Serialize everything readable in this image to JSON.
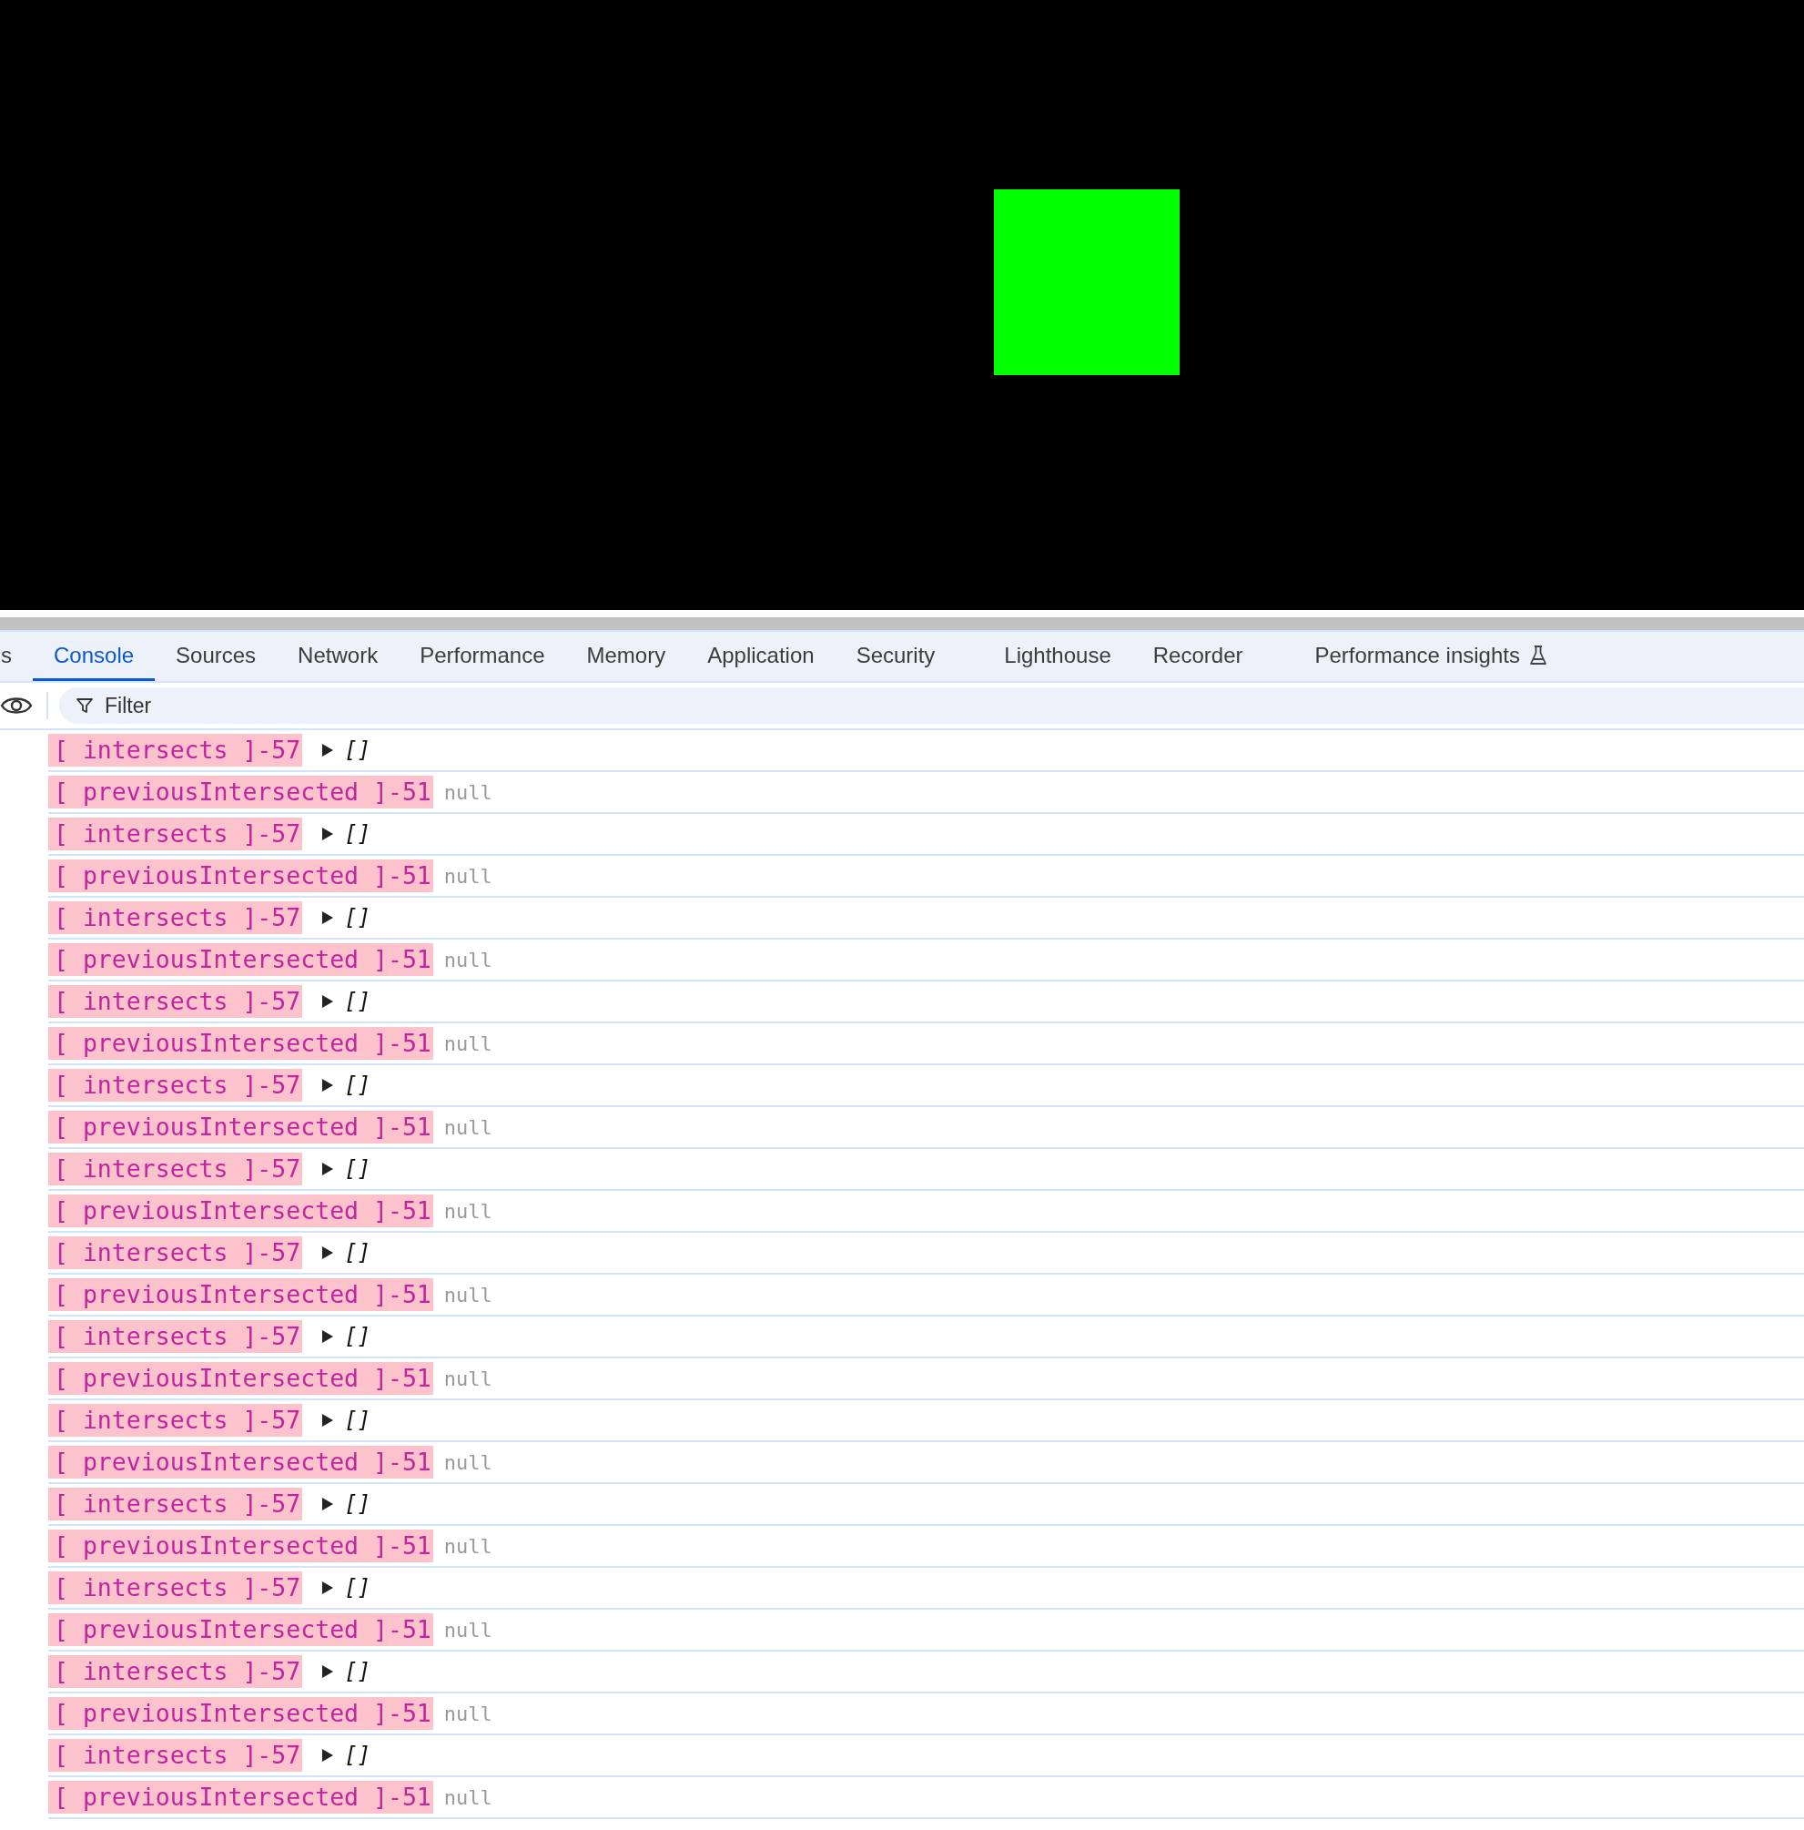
{
  "tabs": [
    {
      "label": "s",
      "selected": false
    },
    {
      "label": "Console",
      "selected": true
    },
    {
      "label": "Sources",
      "selected": false
    },
    {
      "label": "Network",
      "selected": false
    },
    {
      "label": "Performance",
      "selected": false
    },
    {
      "label": "Memory",
      "selected": false
    },
    {
      "label": "Application",
      "selected": false
    },
    {
      "label": "Security",
      "selected": false
    },
    {
      "label": "Lighthouse",
      "selected": false
    },
    {
      "label": "Recorder",
      "selected": false
    },
    {
      "label": "Performance insights",
      "selected": false,
      "experimental": true
    }
  ],
  "filter": {
    "placeholder": "Filter"
  },
  "console": [
    {
      "label": "[ intersects ]-57",
      "kind": "array",
      "value": "[]",
      "expanded": false
    },
    {
      "label": "[ previousIntersected ]-51",
      "kind": "null",
      "value": "null"
    },
    {
      "label": "[ intersects ]-57",
      "kind": "array",
      "value": "[]",
      "expanded": false
    },
    {
      "label": "[ previousIntersected ]-51",
      "kind": "null",
      "value": "null"
    },
    {
      "label": "[ intersects ]-57",
      "kind": "array",
      "value": "[]",
      "expanded": false
    },
    {
      "label": "[ previousIntersected ]-51",
      "kind": "null",
      "value": "null"
    },
    {
      "label": "[ intersects ]-57",
      "kind": "array",
      "value": "[]",
      "expanded": false
    },
    {
      "label": "[ previousIntersected ]-51",
      "kind": "null",
      "value": "null"
    },
    {
      "label": "[ intersects ]-57",
      "kind": "array",
      "value": "[]",
      "expanded": false
    },
    {
      "label": "[ previousIntersected ]-51",
      "kind": "null",
      "value": "null"
    },
    {
      "label": "[ intersects ]-57",
      "kind": "array",
      "value": "[]",
      "expanded": false
    },
    {
      "label": "[ previousIntersected ]-51",
      "kind": "null",
      "value": "null"
    },
    {
      "label": "[ intersects ]-57",
      "kind": "array",
      "value": "[]",
      "expanded": false
    },
    {
      "label": "[ previousIntersected ]-51",
      "kind": "null",
      "value": "null"
    },
    {
      "label": "[ intersects ]-57",
      "kind": "array",
      "value": "[]",
      "expanded": false
    },
    {
      "label": "[ previousIntersected ]-51",
      "kind": "null",
      "value": "null"
    },
    {
      "label": "[ intersects ]-57",
      "kind": "array",
      "value": "[]",
      "expanded": false
    },
    {
      "label": "[ previousIntersected ]-51",
      "kind": "null",
      "value": "null"
    },
    {
      "label": "[ intersects ]-57",
      "kind": "array",
      "value": "[]",
      "expanded": false
    },
    {
      "label": "[ previousIntersected ]-51",
      "kind": "null",
      "value": "null"
    },
    {
      "label": "[ intersects ]-57",
      "kind": "array",
      "value": "[]",
      "expanded": false
    },
    {
      "label": "[ previousIntersected ]-51",
      "kind": "null",
      "value": "null"
    },
    {
      "label": "[ intersects ]-57",
      "kind": "array",
      "value": "[]",
      "expanded": false
    },
    {
      "label": "[ previousIntersected ]-51",
      "kind": "null",
      "value": "null"
    },
    {
      "label": "[ intersects ]-57",
      "kind": "array",
      "value": "[]",
      "expanded": false
    },
    {
      "label": "[ previousIntersected ]-51",
      "kind": "null",
      "value": "null"
    }
  ]
}
